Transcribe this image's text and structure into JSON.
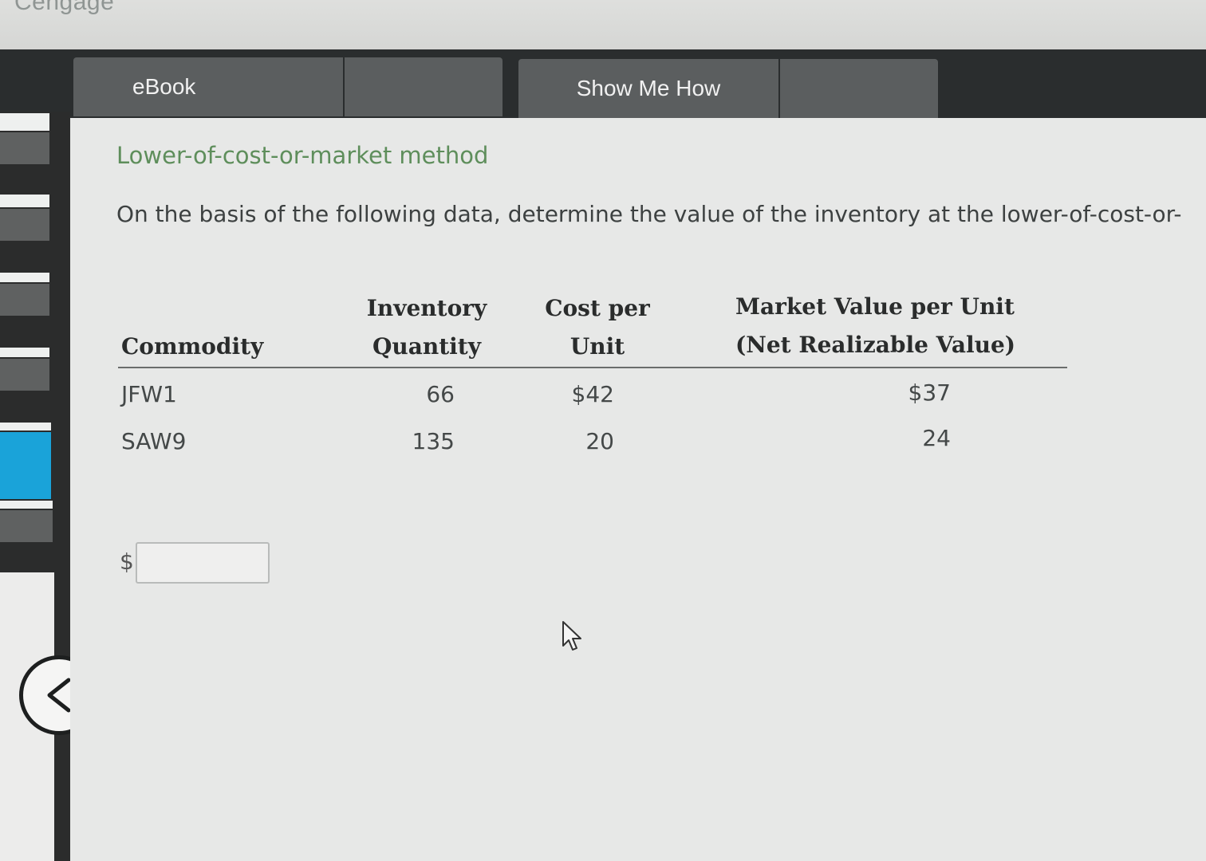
{
  "brand": "Cengage",
  "tabs": {
    "ebook": "eBook",
    "show_me_how": "Show Me How"
  },
  "heading": "Lower-of-cost-or-market method",
  "question": "On the basis of the following data, determine the value of the inventory at the lower-of-cost-or-",
  "table": {
    "headers": {
      "commodity": "Commodity",
      "qty_line1": "Inventory",
      "qty_line2": "Quantity",
      "cost_line1": "Cost per",
      "cost_line2": "Unit",
      "market_line1": "Market Value per Unit",
      "market_line2": "(Net Realizable Value)"
    },
    "rows": [
      {
        "commodity": "JFW1",
        "quantity": "66",
        "cost": "$42",
        "market": "$37"
      },
      {
        "commodity": "SAW9",
        "quantity": "135",
        "cost": "20",
        "market": "24"
      }
    ]
  },
  "answer": {
    "currency_symbol": "$",
    "value": ""
  },
  "icons": {
    "back": "chevron-left-icon",
    "pointer": "mouse-pointer-icon"
  }
}
